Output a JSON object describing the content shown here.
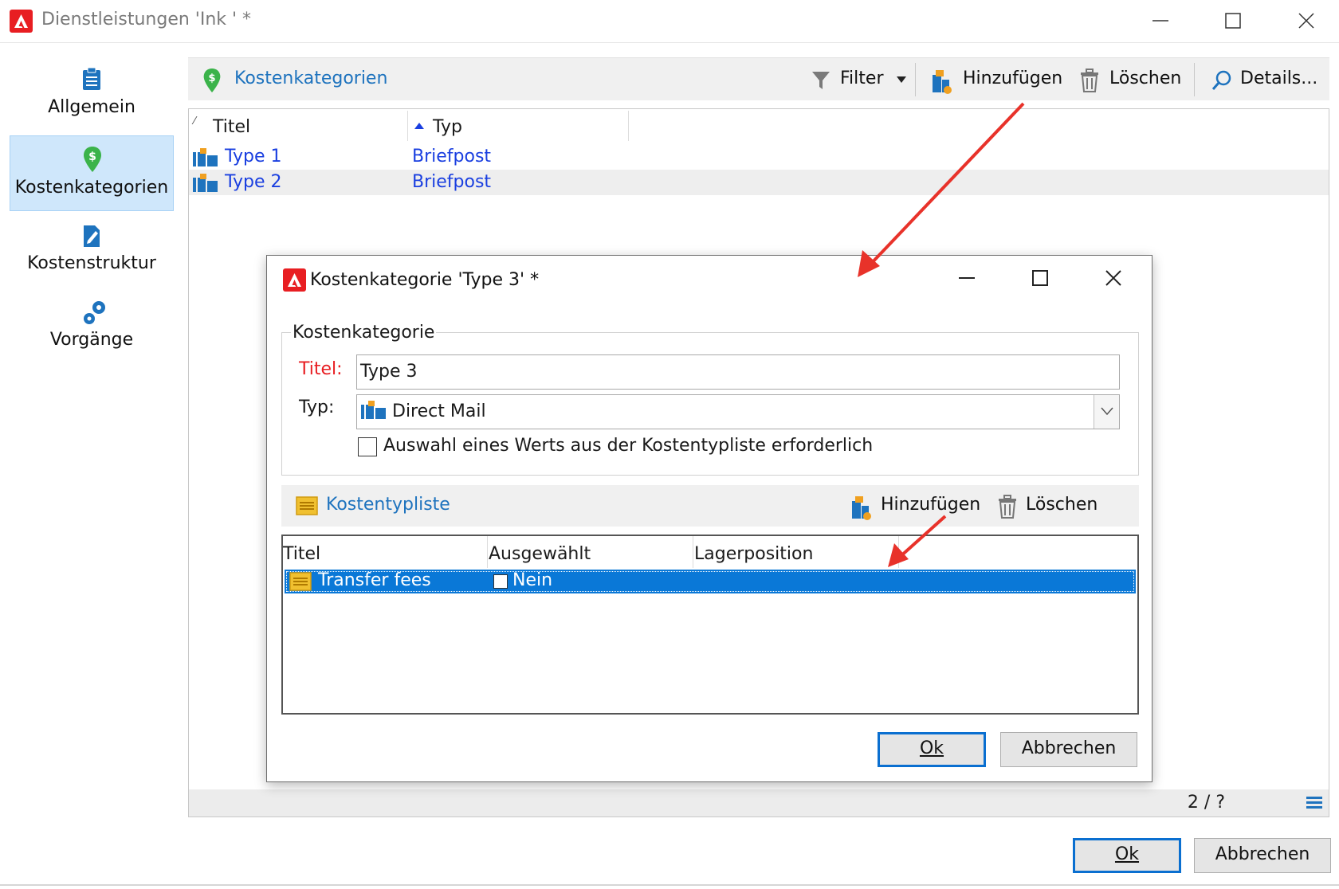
{
  "window": {
    "title": "Dienstleistungen 'Ink ' *"
  },
  "nav": {
    "items": [
      {
        "label": "Allgemein"
      },
      {
        "label": "Kostenkategorien"
      },
      {
        "label": "Kostenstruktur"
      },
      {
        "label": "Vorgänge"
      }
    ]
  },
  "toolbar": {
    "title": "Kostenkategorien",
    "filter_label": "Filter",
    "add_label": "Hinzufügen",
    "delete_label": "Löschen",
    "details_label": "Details..."
  },
  "grid": {
    "columns": [
      "Titel",
      "Typ"
    ],
    "rows": [
      {
        "title": "Type 1",
        "type": "Briefpost"
      },
      {
        "title": "Type 2",
        "type": "Briefpost"
      }
    ],
    "count": "2 / ?"
  },
  "buttons": {
    "ok_label": "Ok",
    "cancel_label": "Abbrechen"
  },
  "dialog": {
    "title": "Kostenkategorie 'Type 3' *",
    "group_label": "Kostenkategorie",
    "title_label": "Titel:",
    "title_value": "Type 3",
    "type_label": "Typ:",
    "type_value": "Direct Mail",
    "checkbox_label": "Auswahl eines Werts aus der Kostentypliste erforderlich",
    "list_title": "Kostentypliste",
    "add_label": "Hinzufügen",
    "delete_label": "Löschen",
    "columns": [
      "Titel",
      "Ausgewählt",
      "Lagerposition"
    ],
    "rows": [
      {
        "title": "Transfer fees",
        "selected": "Nein"
      }
    ],
    "ok_label": "Ok",
    "cancel_label": "Abbrechen"
  },
  "colors": {
    "accent": "#0a78d7",
    "link_blue": "#1a3fe0",
    "brand_red": "#e81e22",
    "annotation_arrow": "#e8322a",
    "required_label": "#e81e22"
  }
}
